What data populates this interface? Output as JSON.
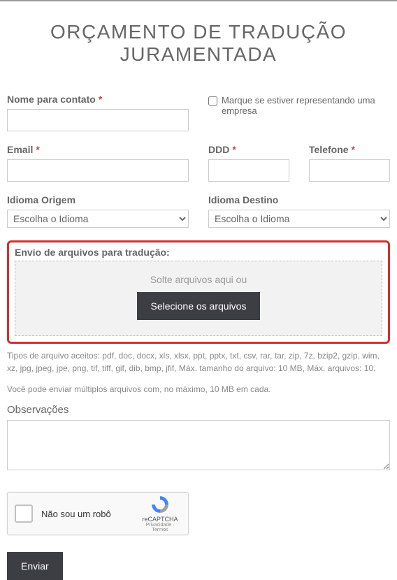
{
  "title": "ORÇAMENTO DE TRADUÇÃO JURAMENTADA",
  "fields": {
    "name_label": "Nome para contato",
    "company_checkbox": "Marque se estiver representando uma empresa",
    "email_label": "Email",
    "ddd_label": "DDD",
    "phone_label": "Telefone",
    "lang_src_label": "Idioma Origem",
    "lang_dst_label": "Idioma Destino",
    "lang_placeholder": "Escolha o Idioma"
  },
  "upload": {
    "label": "Envio de arquivos para tradução:",
    "drop_text": "Solte arquivos aqui ou",
    "button": "Selecione os arquivos"
  },
  "hints": {
    "types": "Tipos de arquivo aceitos: pdf, doc, docx, xls, xlsx, ppt, pptx, txt, csv, rar, tar, zip, 7z, bzip2, gzip, wim, xz, jpg, jpeg, jpe, png, tif, tiff, gif, dib, bmp, jfif, Máx. tamanho do arquivo: 10 MB, Máx. arquivos: 10.",
    "multi": "Você pode enviar múltiplos arquivos com, no máximo, 10 MB em cada."
  },
  "obs_label": "Observações",
  "recaptcha": {
    "label": "Não sou um robô",
    "brand": "reCAPTCHA",
    "terms": "Privacidade · Termos"
  },
  "submit": "Enviar",
  "required_mark": "*"
}
